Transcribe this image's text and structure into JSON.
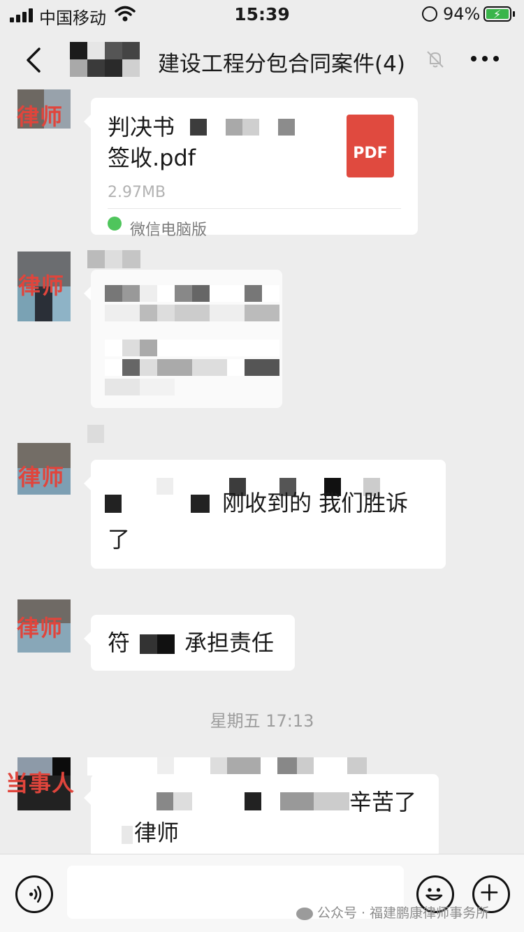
{
  "status_bar": {
    "carrier": "中国移动",
    "time": "15:39",
    "battery_percent": "94%"
  },
  "header": {
    "title": "建设工程分包合同案件(4)",
    "icons": [
      "back-icon",
      "mute-icon",
      "more-icon"
    ]
  },
  "messages": [
    {
      "type": "file",
      "sender_tag": "律师",
      "file_name_line1": "判决书",
      "file_name_line2": "签收.pdf",
      "file_size": "2.97MB",
      "file_badge": "PDF",
      "source": "微信电脑版"
    },
    {
      "type": "text",
      "sender_tag": "律师",
      "redacted": true
    },
    {
      "type": "text",
      "sender_tag": "律师",
      "text_line1": "刚收到的  我们胜诉",
      "text_line2": "了"
    },
    {
      "type": "text",
      "sender_tag": "律师",
      "text_prefix": "符",
      "text_suffix": "承担责任"
    },
    {
      "type": "text",
      "sender_tag": "当事人",
      "text_line1": "辛苦了",
      "text_line2": "律师"
    }
  ],
  "timestamp": "星期五 17:13",
  "input_bar": {
    "placeholder": "",
    "icons": [
      "voice-icon",
      "emoji-icon",
      "plus-icon"
    ]
  },
  "watermark": "公众号 · 福建鹏康律师事务所",
  "colors": {
    "background": "#ededed",
    "bubble": "#ffffff",
    "tag_red": "#e0453c",
    "pdf_red": "#e04a3f",
    "battery_green": "#3ab54a"
  }
}
